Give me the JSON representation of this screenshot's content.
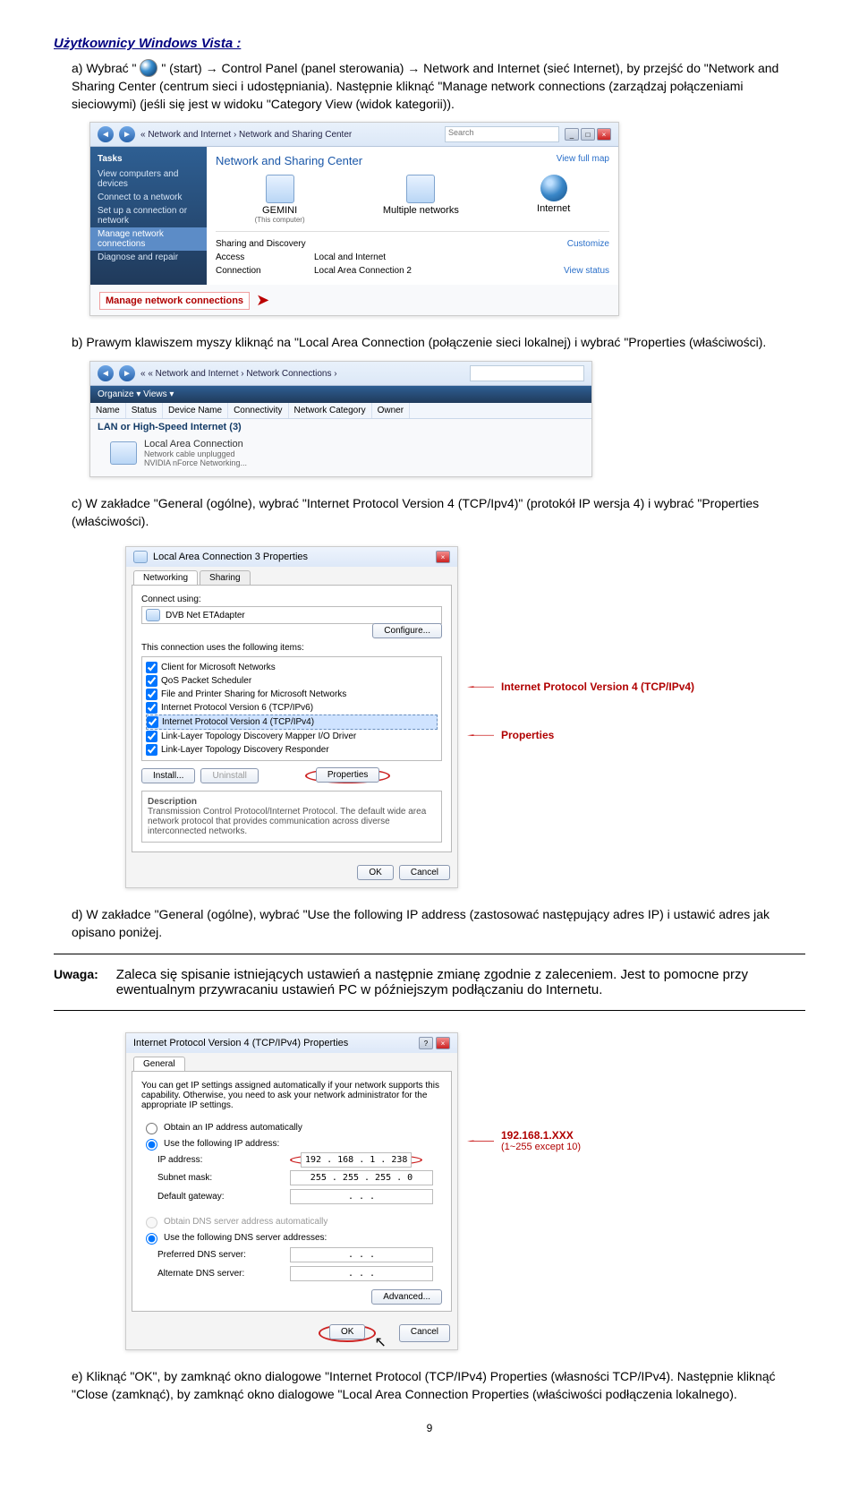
{
  "heading": "Użytkownicy Windows Vista :",
  "steps": {
    "a": "a)  Wybrać \"",
    "a2": "\" (start) → Control Panel (panel sterowania) → Network and Internet (sieć Internet), by przejść do \"Network and Sharing Center (centrum sieci i udostępniania). Następnie kliknąć \"Manage network connections (zarządzaj połączeniami sieciowymi) (jeśli się jest w widoku \"Category View (widok kategorii)).",
    "b": "b)  Prawym klawiszem myszy kliknąć na \"Local Area Connection (połączenie sieci lokalnej) i wybrać \"Properties (właściwości).",
    "c": "c)  W zakładce \"General (ogólne), wybrać \"Internet Protocol Version 4 (TCP/Ipv4)\" (protokół IP wersja 4) i wybrać \"Properties (właściwości).",
    "d": "d)  W zakładce \"General (ogólne), wybrać \"Use the following IP address (zastosować następujący adres IP) i ustawić adres jak opisano poniżej.",
    "e": "e)  Kliknąć \"OK\", by zamknąć okno dialogowe \"Internet Protocol (TCP/IPv4) Properties (własności TCP/IPv4). Następnie kliknąć \"Close (zamknąć), by zamknąć okno dialogowe \"Local Area Connection Properties (właściwości podłączenia lokalnego)."
  },
  "uwaga_label": "Uwaga:",
  "uwaga_text": "Zaleca się spisanie istniejących ustawień a następnie zmianę zgodnie z zaleceniem. Jest to pomocne przy ewentualnym przywracaniu ustawień PC w późniejszym podłączaniu do Internetu.",
  "pagenum": "9",
  "sc1": {
    "breadcrumb": "« Network and Internet  ›  Network and Sharing Center",
    "search_ph": "Search",
    "tasks": "Tasks",
    "side1": "View computers and devices",
    "side2": "Connect to a network",
    "side3": "Set up a connection or network",
    "side4": "Manage network connections",
    "side5": "Diagnose and repair",
    "title": "Network and Sharing Center",
    "viewmap": "View full map",
    "ic1": "GEMINI",
    "ic1s": "(This computer)",
    "ic2": "Multiple networks",
    "ic3": "Internet",
    "r1a": "Sharing and Discovery",
    "r1c": "Customize",
    "r2a": "Access",
    "r2b": "Local and Internet",
    "r3a": "Connection",
    "r3b": "Local Area Connection 2",
    "r3c": "View status",
    "callout": "Manage network connections"
  },
  "sc2": {
    "breadcrumb": "«  « Network and Internet  ›  Network Connections  ›",
    "org": "Organize ▾    Views ▾",
    "c1": "Name",
    "c2": "Status",
    "c3": "Device Name",
    "c4": "Connectivity",
    "c5": "Network Category",
    "c6": "Owner",
    "cat": "LAN or High-Speed Internet (3)",
    "name": "Local Area Connection",
    "sub1": "Network cable unplugged",
    "sub2": "NVIDIA nForce Networking..."
  },
  "sc3": {
    "title": "Local Area Connection 3 Properties",
    "tab1": "Networking",
    "tab2": "Sharing",
    "connect_using": "Connect using:",
    "adapter": "DVB Net ETAdapter",
    "configure": "Configure...",
    "items_label": "This connection uses the following items:",
    "i1": "Client for Microsoft Networks",
    "i2": "QoS Packet Scheduler",
    "i3": "File and Printer Sharing for Microsoft Networks",
    "i4": "Internet Protocol Version 6 (TCP/IPv6)",
    "i5": "Internet Protocol Version 4 (TCP/IPv4)",
    "i6": "Link-Layer Topology Discovery Mapper I/O Driver",
    "i7": "Link-Layer Topology Discovery Responder",
    "install": "Install...",
    "uninstall": "Uninstall",
    "properties": "Properties",
    "desc_h": "Description",
    "desc_b": "Transmission Control Protocol/Internet Protocol. The default wide area network protocol that provides communication across diverse interconnected networks.",
    "ok": "OK",
    "cancel": "Cancel",
    "call1": "Internet Protocol Version 4 (TCP/IPv4)",
    "call2": "Properties"
  },
  "sc4": {
    "title": "Internet Protocol Version 4 (TCP/IPv4) Properties",
    "tab": "General",
    "intro": "You can get IP settings assigned automatically if your network supports this capability. Otherwise, you need to ask your network administrator for the appropriate IP settings.",
    "r1": "Obtain an IP address automatically",
    "r2": "Use the following IP address:",
    "ip_l": "IP address:",
    "ip_v": "192 . 168 .   1  . 238",
    "sm_l": "Subnet mask:",
    "sm_v": "255 . 255 . 255 .  0 ",
    "gw_l": "Default gateway:",
    "gw_v": "   .    .    .   ",
    "r3": "Obtain DNS server address automatically",
    "r4": "Use the following DNS server addresses:",
    "pd_l": "Preferred DNS server:",
    "pd_v": "   .    .    .   ",
    "ad_l": "Alternate DNS server:",
    "ad_v": "   .    .    .   ",
    "adv": "Advanced...",
    "ok": "OK",
    "cancel": "Cancel",
    "call_ip": "192.168.1.XXX",
    "call_ip2": "(1~255 except 10)"
  }
}
